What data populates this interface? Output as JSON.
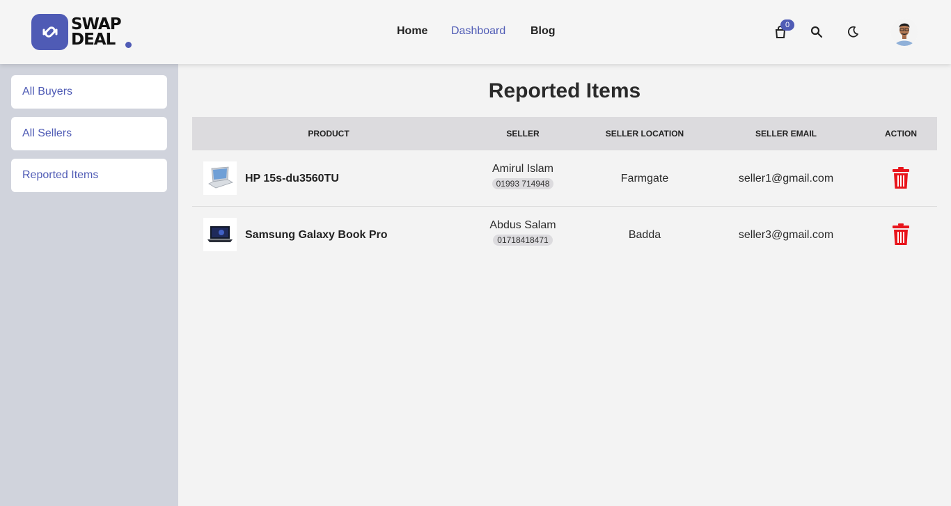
{
  "brand": {
    "line1": "SWAP",
    "line2": "DEAL",
    "accent": "#4f5bb5",
    "icon": "swap-arrows-icon"
  },
  "nav": {
    "home": "Home",
    "dashboard": "Dashboard",
    "blog": "Blog"
  },
  "header": {
    "cart_count": "0",
    "cart_icon": "shopping-bag-icon",
    "search_icon": "search-icon",
    "theme_icon": "moon-icon",
    "avatar_icon": "user-avatar"
  },
  "sidebar": {
    "items": [
      {
        "label": "All Buyers"
      },
      {
        "label": "All Sellers"
      },
      {
        "label": "Reported Items"
      }
    ]
  },
  "page": {
    "title": "Reported Items"
  },
  "table": {
    "headers": {
      "product": "Product",
      "seller": "Seller",
      "location": "Seller Location",
      "email": "Seller Email",
      "action": "Action"
    },
    "rows": [
      {
        "product": "HP 15s-du3560TU",
        "seller": "Amirul Islam",
        "phone": "01993 714948",
        "location": "Farmgate",
        "email": "seller1@gmail.com",
        "action_icon": "trash-icon"
      },
      {
        "product": "Samsung Galaxy Book Pro",
        "seller": "Abdus Salam",
        "phone": "01718418471",
        "location": "Badda",
        "email": "seller3@gmail.com",
        "action_icon": "trash-icon"
      }
    ]
  },
  "colors": {
    "danger": "#e8141b",
    "sidebar_bg": "#d0d3dc",
    "header_row_bg": "#dcdbde"
  }
}
